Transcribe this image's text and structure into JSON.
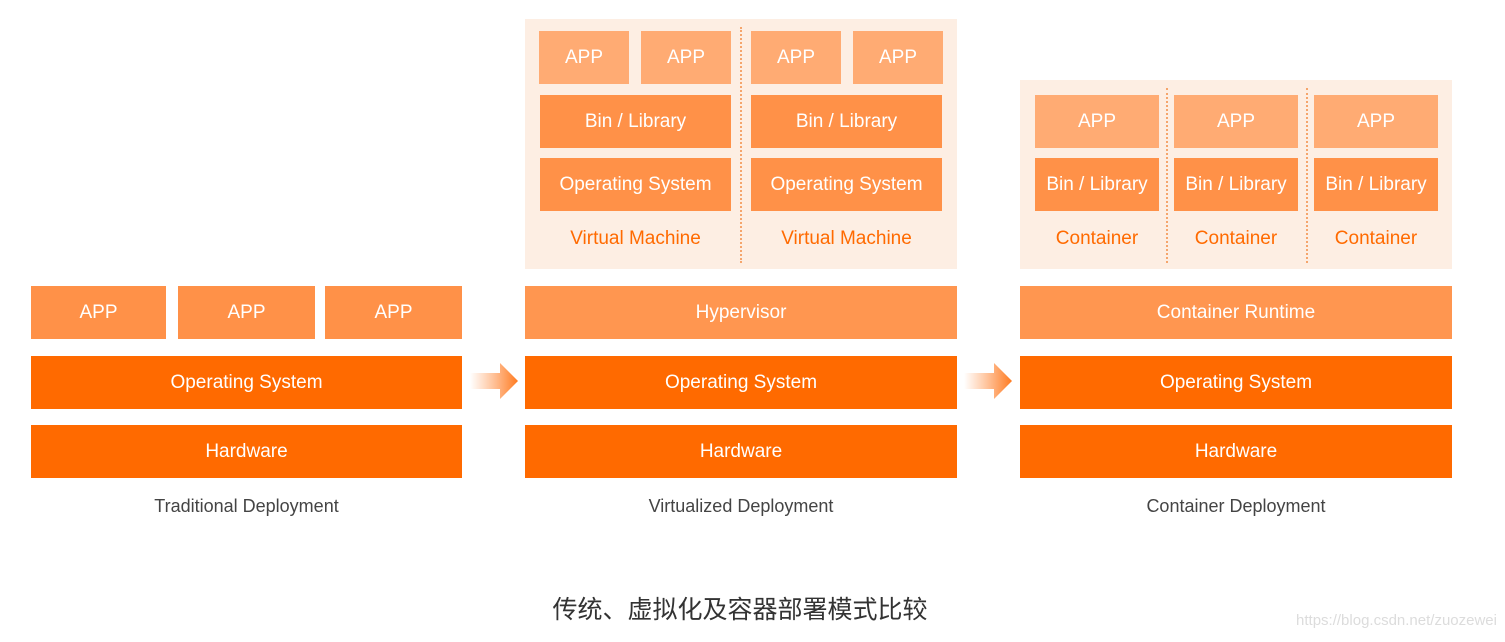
{
  "colors": {
    "app": "#ffab73",
    "bin_library": "#ff9148",
    "layer_light": "#ff9650",
    "layer_dark": "#ff6a00",
    "panel_bg": "#fdeee3",
    "label_accent": "#ff6a00",
    "caption": "#444444"
  },
  "traditional": {
    "apps": [
      "APP",
      "APP",
      "APP"
    ],
    "os": "Operating System",
    "hardware": "Hardware",
    "caption": "Traditional Deployment"
  },
  "virtualized": {
    "vms": [
      {
        "apps": [
          "APP",
          "APP"
        ],
        "bin": "Bin / Library",
        "os": "Operating System",
        "label": "Virtual Machine"
      },
      {
        "apps": [
          "APP",
          "APP"
        ],
        "bin": "Bin / Library",
        "os": "Operating System",
        "label": "Virtual Machine"
      }
    ],
    "hypervisor": "Hypervisor",
    "os": "Operating System",
    "hardware": "Hardware",
    "caption": "Virtualized Deployment"
  },
  "container": {
    "containers": [
      {
        "app": "APP",
        "bin": "Bin / Library",
        "label": "Container"
      },
      {
        "app": "APP",
        "bin": "Bin / Library",
        "label": "Container"
      },
      {
        "app": "APP",
        "bin": "Bin / Library",
        "label": "Container"
      }
    ],
    "runtime": "Container Runtime",
    "os": "Operating System",
    "hardware": "Hardware",
    "caption": "Container Deployment"
  },
  "arrows": [
    "arrow-right-icon",
    "arrow-right-icon"
  ],
  "title": "传统、虚拟化及容器部署模式比较",
  "watermark": "https://blog.csdn.net/zuozewei"
}
